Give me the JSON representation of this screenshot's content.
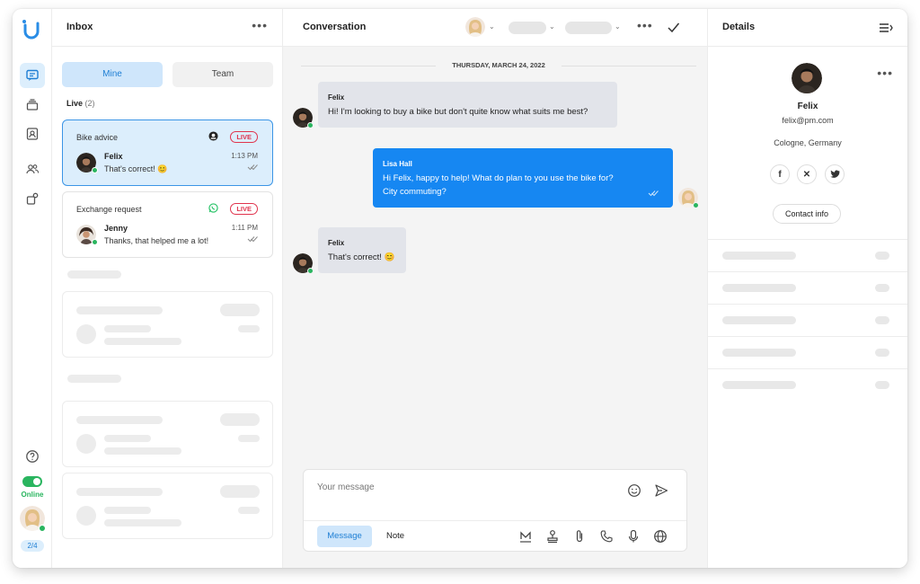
{
  "rail": {
    "items": [
      "chat-icon",
      "archive-icon",
      "contacts-icon",
      "team-icon",
      "integrations-icon"
    ],
    "status_label": "Online",
    "page_indicator": "2/4",
    "help_icon": "help-icon"
  },
  "inbox": {
    "title": "Inbox",
    "tabs": {
      "mine": "Mine",
      "team": "Team"
    },
    "live_label": "Live",
    "live_count": "(2)",
    "conversations": [
      {
        "subject": "Bike advice",
        "badge": "LIVE",
        "name": "Felix",
        "preview": "That's correct! 😊",
        "time": "1:13 PM",
        "channel": "webchat-icon"
      },
      {
        "subject": "Exchange request",
        "badge": "LIVE",
        "name": "Jenny",
        "preview": "Thanks, that helped me a lot!",
        "time": "1:11 PM",
        "channel": "whatsapp-icon"
      }
    ]
  },
  "conversation": {
    "title": "Conversation",
    "date": "THURSDAY, MARCH 24, 2022",
    "messages": [
      {
        "sender": "Felix",
        "lines": [
          "Hi! I'm looking to buy a bike but don't quite know what suits me best?"
        ],
        "direction": "in"
      },
      {
        "sender": "Lisa Hall",
        "lines": [
          "Hi Felix, happy to help! What do plan to you use the bike for?",
          "City commuting?"
        ],
        "direction": "out"
      },
      {
        "sender": "Felix",
        "lines": [
          "That's correct! 😊"
        ],
        "direction": "in"
      }
    ],
    "composer": {
      "placeholder": "Your message",
      "tab_message": "Message",
      "tab_note": "Note"
    }
  },
  "details": {
    "title": "Details",
    "name": "Felix",
    "email": "felix@pm.com",
    "location": "Cologne, Germany",
    "social": [
      "f",
      "x",
      "t"
    ],
    "contact_button": "Contact info"
  },
  "colors": {
    "accent": "#1687f2",
    "live": "#e0344d",
    "online": "#2ab55f"
  }
}
